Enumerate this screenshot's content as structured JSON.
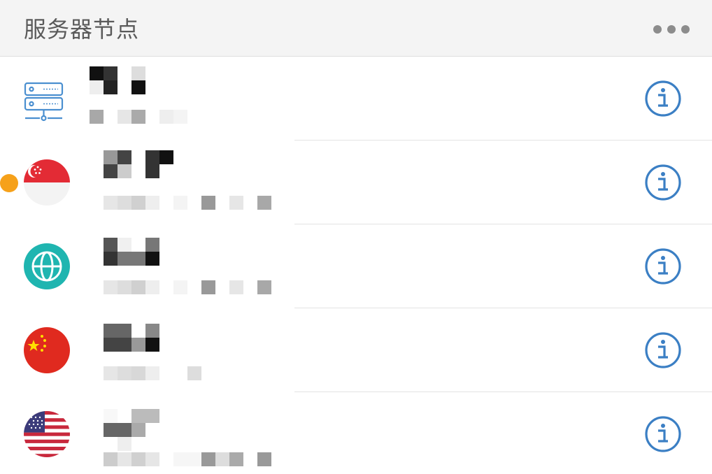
{
  "header": {
    "title": "服务器节点",
    "more_icon": "more-horizontal-icon"
  },
  "colors": {
    "accent": "#3b7fc4",
    "active_dot": "#f6a11a",
    "globe_teal": "#1fb5b0",
    "server_icon": "#4a8fd0"
  },
  "active_row_index": 1,
  "nodes": [
    {
      "icon": "server-icon",
      "info_icon": "info-icon"
    },
    {
      "icon": "singapore-flag-icon",
      "info_icon": "info-icon"
    },
    {
      "icon": "globe-icon",
      "info_icon": "info-icon"
    },
    {
      "icon": "china-flag-icon",
      "info_icon": "info-icon"
    },
    {
      "icon": "usa-flag-icon",
      "info_icon": "info-icon"
    }
  ]
}
